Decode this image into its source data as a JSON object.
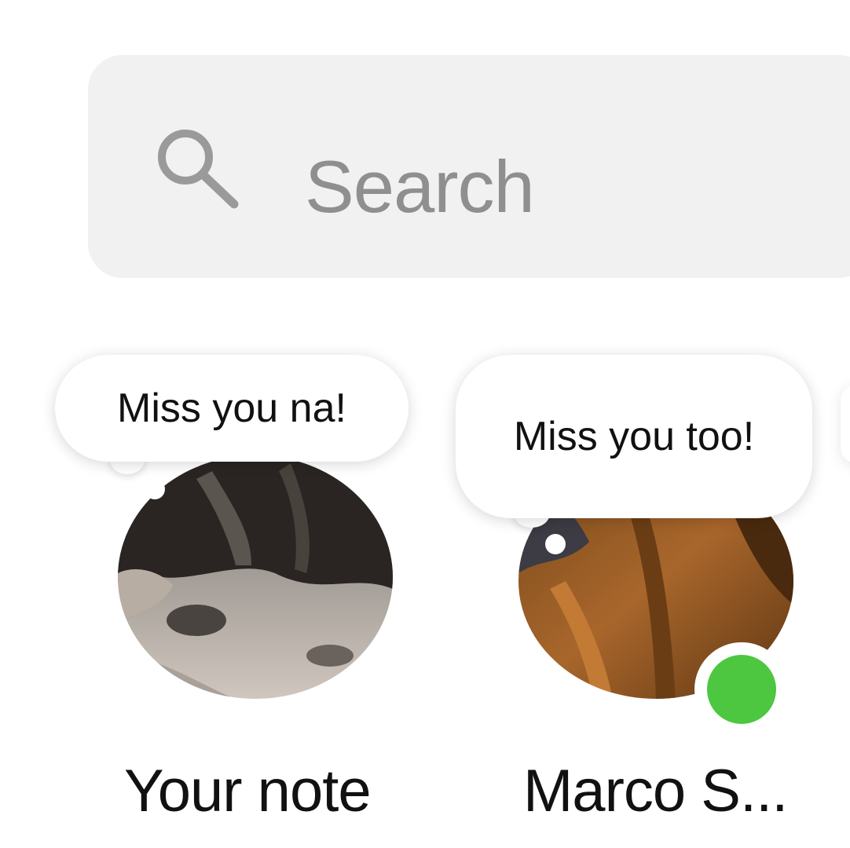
{
  "search": {
    "placeholder": "Search",
    "icon": "search-icon"
  },
  "notes": [
    {
      "note_text": "Miss you na!",
      "name": "Your note",
      "online": false
    },
    {
      "note_text": "Miss you too!",
      "name": "Marco S...",
      "online": true
    }
  ],
  "colors": {
    "search_bg": "#f1f1f1",
    "placeholder": "#8f8f8f",
    "online": "#4cc73f",
    "text": "#111111"
  }
}
